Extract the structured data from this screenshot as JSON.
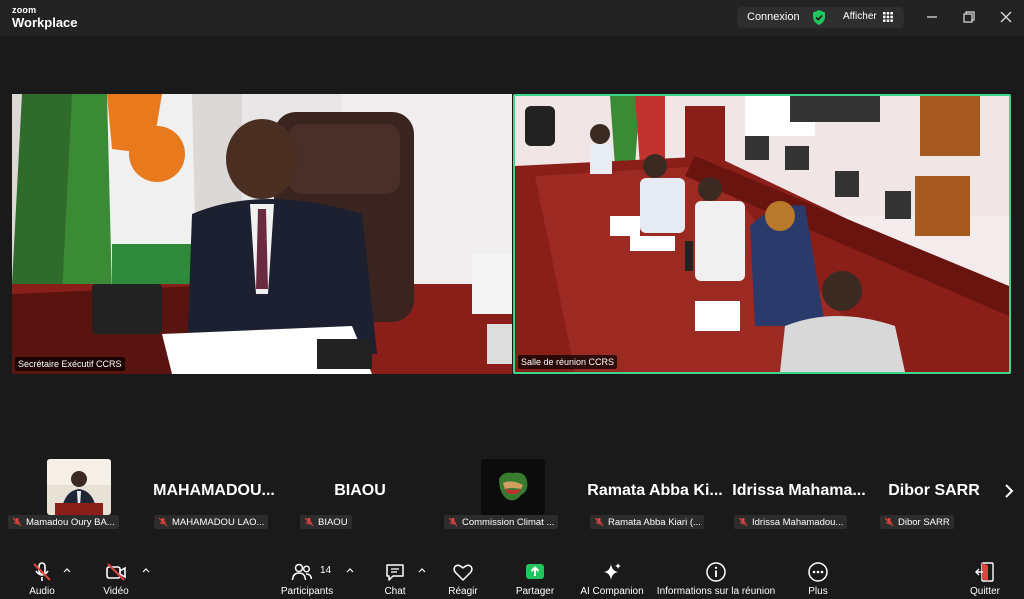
{
  "app": {
    "brand_small": "zoom",
    "brand_large": "Workplace"
  },
  "titlebar": {
    "connection_label": "Connexion",
    "show_label": "Afficher"
  },
  "colors": {
    "accent_green": "#3dd68c",
    "muted_red": "#e0443c",
    "share_green": "#22c55e"
  },
  "videos": [
    {
      "label": "Secrétaire Exécutif CCRS"
    },
    {
      "label": "Salle de réunion CCRS"
    }
  ],
  "gallery": [
    {
      "big": "",
      "name": "Mamadou Oury BA...",
      "has_thumb": true
    },
    {
      "big": "MAHAMADOU...",
      "name": "MAHAMADOU LAO..."
    },
    {
      "big": "BIAOU",
      "name": "BIAOU"
    },
    {
      "big": "",
      "name": "Commission Climat ...",
      "has_thumb": true
    },
    {
      "big": "Ramata  Abba  Ki...",
      "name": "Ramata Abba Kiari (..."
    },
    {
      "big": "Idrissa  Mahama...",
      "name": "Idrissa Mahamadou..."
    },
    {
      "big": "Dibor SARR",
      "name": "Dibor SARR"
    }
  ],
  "toolbar": {
    "audio": "Audio",
    "video": "Vidéo",
    "participants": "Participants",
    "participants_count": "14",
    "chat": "Chat",
    "react": "Réagir",
    "share": "Partager",
    "ai": "AI Companion",
    "info": "Informations sur la réunion",
    "more": "Plus",
    "quit": "Quitter"
  }
}
